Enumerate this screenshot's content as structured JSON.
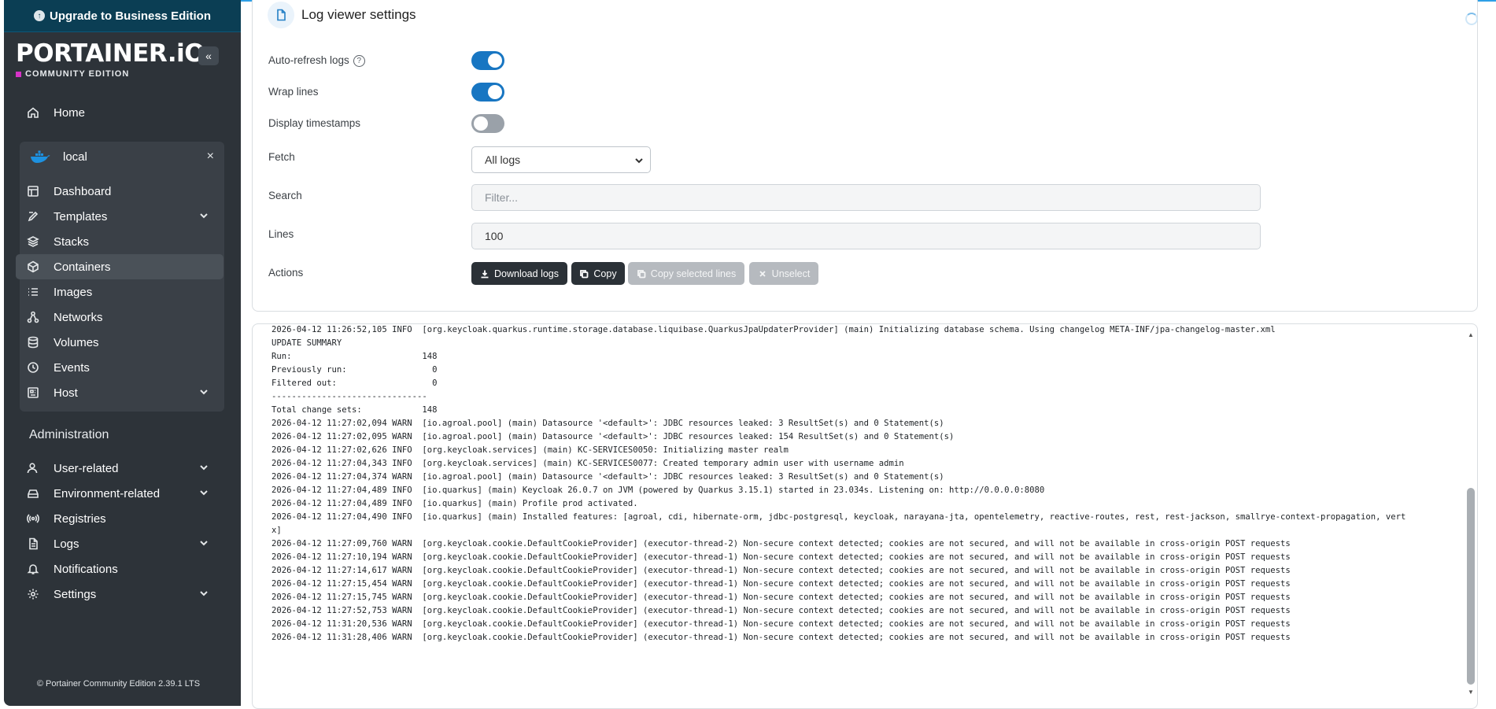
{
  "sidebar": {
    "upgrade_label": "Upgrade to Business Edition",
    "brand": "PORTAINER.iO",
    "edition": "COMMUNITY EDITION",
    "collapse_glyph": "«",
    "home_label": "Home",
    "environment": {
      "name": "local",
      "close_glyph": "×"
    },
    "env_items": [
      {
        "label": "Dashboard",
        "icon": "dashboard-icon"
      },
      {
        "label": "Templates",
        "icon": "templates-icon",
        "expandable": true
      },
      {
        "label": "Stacks",
        "icon": "stacks-icon"
      },
      {
        "label": "Containers",
        "icon": "containers-icon",
        "active": true
      },
      {
        "label": "Images",
        "icon": "images-icon"
      },
      {
        "label": "Networks",
        "icon": "networks-icon"
      },
      {
        "label": "Volumes",
        "icon": "volumes-icon"
      },
      {
        "label": "Events",
        "icon": "events-icon"
      },
      {
        "label": "Host",
        "icon": "host-icon",
        "expandable": true
      }
    ],
    "admin_title": "Administration",
    "admin_items": [
      {
        "label": "User-related",
        "icon": "users-icon",
        "expandable": true
      },
      {
        "label": "Environment-related",
        "icon": "environment-icon",
        "expandable": true
      },
      {
        "label": "Registries",
        "icon": "registries-icon"
      },
      {
        "label": "Logs",
        "icon": "logs-icon",
        "expandable": true
      },
      {
        "label": "Notifications",
        "icon": "bell-icon"
      },
      {
        "label": "Settings",
        "icon": "gear-icon",
        "expandable": true
      }
    ],
    "footer": "© Portainer Community Edition  2.39.1 LTS"
  },
  "settings": {
    "title": "Log viewer settings",
    "auto_refresh_label": "Auto-refresh logs",
    "auto_refresh": true,
    "wrap_lines_label": "Wrap lines",
    "wrap_lines": true,
    "timestamps_label": "Display timestamps",
    "timestamps": false,
    "fetch_label": "Fetch",
    "fetch_value": "All logs",
    "search_label": "Search",
    "search_placeholder": "Filter...",
    "lines_label": "Lines",
    "lines_value": "100",
    "actions_label": "Actions",
    "actions": {
      "download": "Download logs",
      "copy": "Copy",
      "copy_selected": "Copy selected lines",
      "unselect": "Unselect"
    }
  },
  "colors": {
    "sidebar_bg": "#2d3339",
    "upgrade_bg": "#0b3e54",
    "toggle_on": "#1876c2",
    "accent_bar": "#2e9fe6"
  },
  "log_lines": [
    "2026-04-12 11:26:52,105 INFO  [org.keycloak.quarkus.runtime.storage.database.liquibase.QuarkusJpaUpdaterProvider] (main) Initializing database schema. Using changelog META-INF/jpa-changelog-master.xml",
    "UPDATE SUMMARY",
    "Run:                          148",
    "Previously run:                 0",
    "Filtered out:                   0",
    "-------------------------------",
    "Total change sets:            148",
    "2026-04-12 11:27:02,094 WARN  [io.agroal.pool] (main) Datasource '<default>': JDBC resources leaked: 3 ResultSet(s) and 0 Statement(s)",
    "2026-04-12 11:27:02,095 WARN  [io.agroal.pool] (main) Datasource '<default>': JDBC resources leaked: 154 ResultSet(s) and 0 Statement(s)",
    "2026-04-12 11:27:02,626 INFO  [org.keycloak.services] (main) KC-SERVICES0050: Initializing master realm",
    "2026-04-12 11:27:04,343 INFO  [org.keycloak.services] (main) KC-SERVICES0077: Created temporary admin user with username admin",
    "2026-04-12 11:27:04,374 WARN  [io.agroal.pool] (main) Datasource '<default>': JDBC resources leaked: 3 ResultSet(s) and 0 Statement(s)",
    "2026-04-12 11:27:04,489 INFO  [io.quarkus] (main) Keycloak 26.0.7 on JVM (powered by Quarkus 3.15.1) started in 23.034s. Listening on: http://0.0.0.0:8080",
    "2026-04-12 11:27:04,489 INFO  [io.quarkus] (main) Profile prod activated.",
    "2026-04-12 11:27:04,490 INFO  [io.quarkus] (main) Installed features: [agroal, cdi, hibernate-orm, jdbc-postgresql, keycloak, narayana-jta, opentelemetry, reactive-routes, rest, rest-jackson, smallrye-context-propagation, vert",
    "x]",
    "2026-04-12 11:27:09,760 WARN  [org.keycloak.cookie.DefaultCookieProvider] (executor-thread-2) Non-secure context detected; cookies are not secured, and will not be available in cross-origin POST requests",
    "2026-04-12 11:27:10,194 WARN  [org.keycloak.cookie.DefaultCookieProvider] (executor-thread-1) Non-secure context detected; cookies are not secured, and will not be available in cross-origin POST requests",
    "2026-04-12 11:27:14,617 WARN  [org.keycloak.cookie.DefaultCookieProvider] (executor-thread-1) Non-secure context detected; cookies are not secured, and will not be available in cross-origin POST requests",
    "2026-04-12 11:27:15,454 WARN  [org.keycloak.cookie.DefaultCookieProvider] (executor-thread-1) Non-secure context detected; cookies are not secured, and will not be available in cross-origin POST requests",
    "2026-04-12 11:27:15,745 WARN  [org.keycloak.cookie.DefaultCookieProvider] (executor-thread-1) Non-secure context detected; cookies are not secured, and will not be available in cross-origin POST requests",
    "2026-04-12 11:27:52,753 WARN  [org.keycloak.cookie.DefaultCookieProvider] (executor-thread-1) Non-secure context detected; cookies are not secured, and will not be available in cross-origin POST requests",
    "2026-04-12 11:31:20,536 WARN  [org.keycloak.cookie.DefaultCookieProvider] (executor-thread-1) Non-secure context detected; cookies are not secured, and will not be available in cross-origin POST requests",
    "2026-04-12 11:31:28,406 WARN  [org.keycloak.cookie.DefaultCookieProvider] (executor-thread-1) Non-secure context detected; cookies are not secured, and will not be available in cross-origin POST requests"
  ]
}
